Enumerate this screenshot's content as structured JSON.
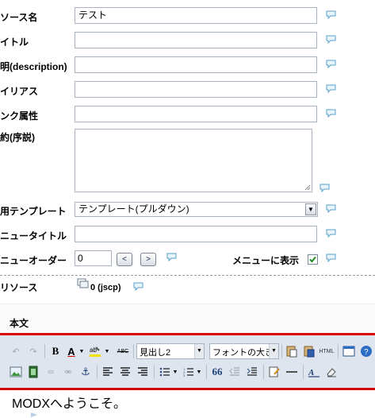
{
  "form": {
    "fields": [
      {
        "label": "ソース名",
        "value": "テスト"
      },
      {
        "label": "イトル",
        "value": ""
      },
      {
        "label": "明(description)",
        "value": ""
      },
      {
        "label": "イリアス",
        "value": ""
      },
      {
        "label": "ンク属性",
        "value": ""
      }
    ],
    "summary_label": "約(序説)",
    "template_label": "用テンプレート",
    "template_value": "テンプレート(プルダウン)",
    "menu_title_label": "ニュータイトル",
    "menu_order_label": "ニューオーダー",
    "menu_order_value": "0",
    "menu_order_prev": "<",
    "menu_order_next": ">",
    "show_in_menu_label": "メニューに表示",
    "show_in_menu_checked": true,
    "parent_label": "リソース",
    "parent_value": "0 (jscp)"
  },
  "content": {
    "section_label": "本文",
    "editor_text": "MODXへようこそ。",
    "format_select": "見出し2",
    "font_size_select": "フォントの大きさ",
    "toolbar_labels": {
      "bold": "B",
      "font_color": "A",
      "strike_abc": "ABC",
      "html": "HTML",
      "quote": "66"
    }
  },
  "colors": {
    "highlight_border": "#d40000",
    "toolbar_bg": "#dfe5ee",
    "checkbox": "#1c8a1c",
    "bubble": "#5aa0c8"
  }
}
